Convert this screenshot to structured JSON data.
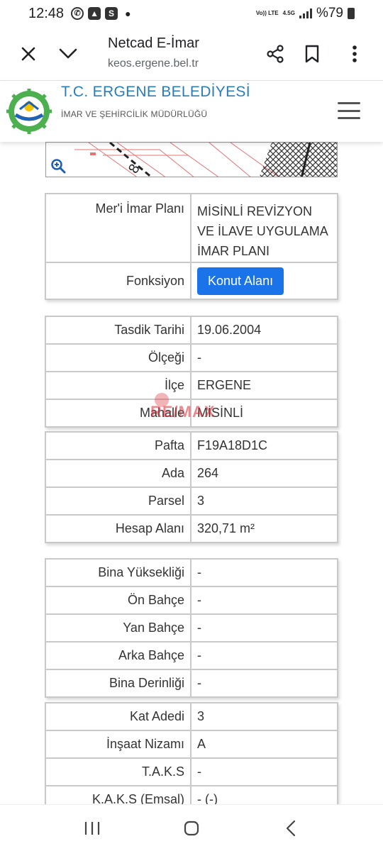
{
  "status_bar": {
    "time": "12:48",
    "network": "4.5G",
    "volte": "Vo)) LTE",
    "battery": "%79"
  },
  "browser": {
    "title": "Netcad E-İmar",
    "url": "keos.ergene.bel.tr"
  },
  "site": {
    "title": "T.C. ERGENE BELEDİYESİ",
    "subtitle": "İMAR VE ŞEHİRCİLİK MÜDÜRLÜĞÜ"
  },
  "watermark": "RE/MAX",
  "plan_table": {
    "rows": [
      {
        "key": "Mer'i İmar Planı",
        "value": "MİSİNLİ REVİZYON VE İLAVE UYGULAMA İMAR PLANI"
      },
      {
        "key": "Fonksiyon",
        "button": "Konut Alanı"
      }
    ]
  },
  "approval_table": {
    "rows": [
      {
        "key": "Tasdik Tarihi",
        "value": "19.06.2004"
      },
      {
        "key": "Ölçeği",
        "value": "-"
      },
      {
        "key": "İlçe",
        "value": "ERGENE"
      },
      {
        "key": "Mahalle",
        "value": "MİSİNLİ"
      }
    ]
  },
  "parcel_table": {
    "rows": [
      {
        "key": "Pafta",
        "value": "F19A18D1C"
      },
      {
        "key": "Ada",
        "value": "264"
      },
      {
        "key": "Parsel",
        "value": "3"
      },
      {
        "key": "Hesap Alanı",
        "value": "320,71 m²"
      }
    ]
  },
  "building_table": {
    "rows": [
      {
        "key": "Bina Yüksekliği",
        "value": "-"
      },
      {
        "key": "Ön Bahçe",
        "value": "-"
      },
      {
        "key": "Yan Bahçe",
        "value": "-"
      },
      {
        "key": "Arka Bahçe",
        "value": "-"
      },
      {
        "key": "Bina Derinliği",
        "value": "-"
      }
    ]
  },
  "floor_table": {
    "rows": [
      {
        "key": "Kat Adedi",
        "value": "3"
      },
      {
        "key": "İnşaat Nizamı",
        "value": "A"
      },
      {
        "key": "T.A.K.S",
        "value": "-"
      },
      {
        "key": "K.A.K.S (Emsal)",
        "value": "- (-)"
      }
    ]
  },
  "colors": {
    "accent_blue": "#1a73e8",
    "brand_blue": "#2a7db8",
    "map_red": "#e57373"
  }
}
